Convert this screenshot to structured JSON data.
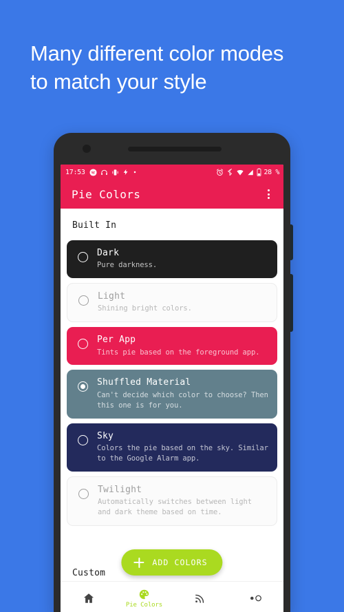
{
  "promo": {
    "background_color": "#3b78e7",
    "headline_line1": "Many different color modes",
    "headline_line2": "to match your style"
  },
  "status_bar": {
    "time": "17:53",
    "battery_text": "28 %",
    "left_icons": [
      "spotify-icon",
      "headphones-icon",
      "vibrate-icon",
      "flash-icon",
      "dot-icon"
    ],
    "right_icons": [
      "alarm-icon",
      "bluetooth-icon",
      "wifi-icon",
      "cellular-signal-icon",
      "battery-icon"
    ],
    "background_color": "#e91e52"
  },
  "app_bar": {
    "title": "Pie Colors",
    "overflow_label": "more-options",
    "background_color": "#e91e52"
  },
  "sections": {
    "built_in": "Built In",
    "custom": "Custom"
  },
  "themes": [
    {
      "id": "dark",
      "title": "Dark",
      "subtitle": "Pure darkness.",
      "selected": false,
      "bg": "#1f1f1f",
      "fg": "#ffffff",
      "pale": false
    },
    {
      "id": "light",
      "title": "Light",
      "subtitle": "Shining bright colors.",
      "selected": false,
      "bg": "#fbfbfb",
      "fg": "#9e9e9e",
      "pale": true
    },
    {
      "id": "per-app",
      "title": "Per App",
      "subtitle": "Tints pie based on the foreground app.",
      "selected": false,
      "bg": "#e91e52",
      "fg": "#ffffff",
      "pale": false
    },
    {
      "id": "shuffled-material",
      "title": "Shuffled Material",
      "subtitle": "Can't decide which color to choose? Then this one is for you.",
      "selected": true,
      "bg": "#62808c",
      "fg": "#ffffff",
      "pale": false
    },
    {
      "id": "sky",
      "title": "Sky",
      "subtitle": "Colors the pie based on the sky. Similar to the Google Alarm app.",
      "selected": false,
      "bg": "#232a5c",
      "fg": "#ffffff",
      "pale": false
    },
    {
      "id": "twilight",
      "title": "Twilight",
      "subtitle": "Automatically switches between light and dark theme based on time.",
      "selected": false,
      "bg": "#fbfbfb",
      "fg": "#9e9e9e",
      "pale": true
    }
  ],
  "fab": {
    "label": "ADD COLORS",
    "icon": "plus-icon",
    "color": "#aada20"
  },
  "bottom_nav": {
    "active_color": "#aada20",
    "items": [
      {
        "id": "home",
        "icon": "home-icon",
        "label": "",
        "active": false
      },
      {
        "id": "pie-colors",
        "icon": "palette-icon",
        "label": "Pie Colors",
        "active": true
      },
      {
        "id": "feed",
        "icon": "rss-icon",
        "label": "",
        "active": false
      },
      {
        "id": "more",
        "icon": "toggle-circles-icon",
        "label": "",
        "active": false
      }
    ]
  }
}
